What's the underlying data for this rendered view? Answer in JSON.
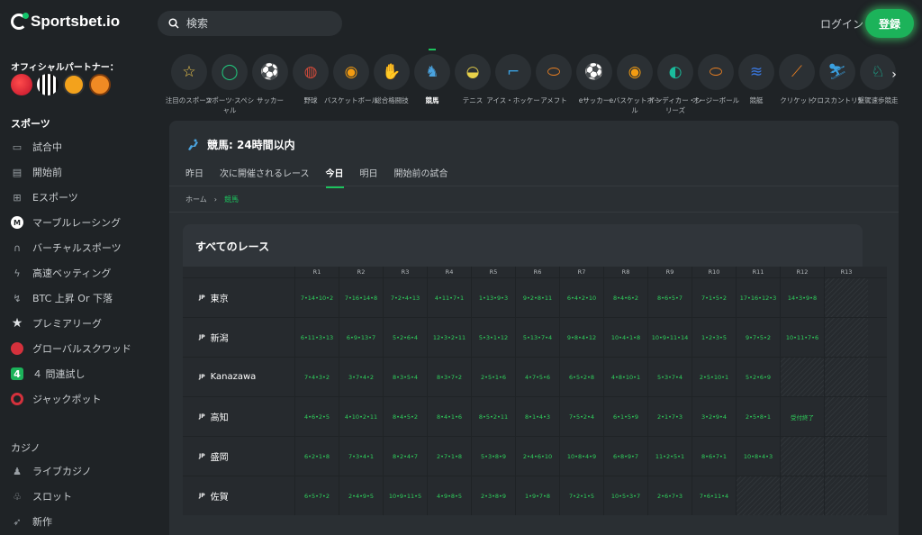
{
  "header": {
    "logo": "Sportsbet.io",
    "search_placeholder": "検索",
    "login": "ログイン",
    "register": "登録"
  },
  "sidebar": {
    "partner_label": "オフィシャルパートナー：",
    "partners": [
      "laliga",
      "newcastle",
      "wolves",
      "basketball"
    ],
    "sports_title": "スポーツ",
    "items": [
      {
        "label": "試合中",
        "icon": "monitor-icon"
      },
      {
        "label": "開始前",
        "icon": "calendar-icon"
      },
      {
        "label": "Eスポーツ",
        "icon": "gamepad-icon"
      },
      {
        "label": "マーブルレーシング",
        "icon": "marble-icon"
      },
      {
        "label": "バーチャルスポーツ",
        "icon": "headset-icon"
      },
      {
        "label": "高速ベッティング",
        "icon": "lightning-icon"
      },
      {
        "label": "BTC 上昇 Or 下落",
        "icon": "btc-icon"
      },
      {
        "label": "プレミアリーグ",
        "icon": "star-icon"
      },
      {
        "label": "グローバルスクワッド",
        "icon": "squad-icon"
      },
      {
        "label": "４ 問連試し",
        "icon": "four-icon"
      },
      {
        "label": "ジャックポット",
        "icon": "target-icon"
      }
    ],
    "casino_title": "カジノ",
    "casino_items": [
      {
        "label": "ライブカジノ",
        "icon": "dealer-icon"
      },
      {
        "label": "スロット",
        "icon": "slot-icon"
      },
      {
        "label": "新作",
        "icon": "rocket-icon"
      }
    ]
  },
  "categories": [
    {
      "label": "注目のスポーツ",
      "icon": "star-icon",
      "color": "#f2c94c"
    },
    {
      "label": "スポーツ·スペシャル",
      "icon": "special-icon",
      "color": "#21c07a"
    },
    {
      "label": "サッカー",
      "icon": "soccer-icon",
      "color": "#e53935"
    },
    {
      "label": "野球",
      "icon": "baseball-icon",
      "color": "#d04a3a"
    },
    {
      "label": "バスケットボール",
      "icon": "basketball-icon",
      "color": "#f39c12"
    },
    {
      "label": "総合格闘技",
      "icon": "glove-icon",
      "color": "#e0e0e0"
    },
    {
      "label": "競馬",
      "icon": "horse-icon",
      "color": "#4aa3df",
      "active": true
    },
    {
      "label": "テニス",
      "icon": "tennis-icon",
      "color": "#e8d14a"
    },
    {
      "label": "アイス・ホッケー",
      "icon": "hockey-icon",
      "color": "#3aa0e0"
    },
    {
      "label": "アメフト",
      "icon": "football-icon",
      "color": "#e67e22"
    },
    {
      "label": "eサッカー",
      "icon": "esoccer-icon",
      "color": "#e53935"
    },
    {
      "label": "eバスケットボール",
      "icon": "ebasketball-icon",
      "color": "#f39c12"
    },
    {
      "label": "インディカー・シリーズ",
      "icon": "helmet-icon",
      "color": "#1abc9c"
    },
    {
      "label": "オージーボール",
      "icon": "aussie-icon",
      "color": "#e67e22"
    },
    {
      "label": "競艇",
      "icon": "boat-icon",
      "color": "#3a78e0"
    },
    {
      "label": "クリケット",
      "icon": "cricket-icon",
      "color": "#e67e22"
    },
    {
      "label": "クロスカントリー",
      "icon": "skier-icon",
      "color": "#3aa0e0"
    },
    {
      "label": "繋駕速歩競走",
      "icon": "trotting-icon",
      "color": "#1abc9c"
    }
  ],
  "panel": {
    "title": "競馬: 24時間以内",
    "tabs": [
      "昨日",
      "次に開催されるレース",
      "今日",
      "明日",
      "開始前の試合"
    ],
    "active_tab": 2,
    "breadcrumb": {
      "home": "ホーム",
      "current": "競馬"
    },
    "races_title": "すべてのレース",
    "columns": [
      "R1",
      "R2",
      "R3",
      "R4",
      "R5",
      "R6",
      "R7",
      "R8",
      "R9",
      "R10",
      "R11",
      "R12",
      "R13"
    ],
    "rows": [
      {
        "country": "JP",
        "venue": "東京",
        "cells": [
          "7•14•10•2",
          "7•16•14•8",
          "7•2•4•13",
          "4•11•7•1",
          "1•13•9•3",
          "9•2•8•11",
          "6•4•2•10",
          "8•4•6•2",
          "8•6•5•7",
          "7•1•5•2",
          "17•16•12•3",
          "14•3•9•8",
          ""
        ]
      },
      {
        "country": "JP",
        "venue": "新潟",
        "cells": [
          "6•11•3•13",
          "6•9•13•7",
          "5•2•6•4",
          "12•3•2•11",
          "5•3•1•12",
          "5•13•7•4",
          "9•8•4•12",
          "10•4•1•8",
          "10•9•11•14",
          "1•2•3•5",
          "9•7•5•2",
          "10•11•7•6",
          ""
        ]
      },
      {
        "country": "JP",
        "venue": "Kanazawa",
        "cells": [
          "7•4•3•2",
          "3•7•4•2",
          "8•3•5•4",
          "8•3•7•2",
          "2•5•1•6",
          "4•7•5•6",
          "6•5•2•8",
          "4•8•10•1",
          "5•3•7•4",
          "2•5•10•1",
          "5•2•6•9",
          "",
          ""
        ]
      },
      {
        "country": "JP",
        "venue": "高知",
        "cells": [
          "4•6•2•5",
          "4•10•2•11",
          "8•4•5•2",
          "8•4•1•6",
          "8•5•2•11",
          "8•1•4•3",
          "7•5•2•4",
          "6•1•5•9",
          "2•1•7•3",
          "3•2•9•4",
          "2•5•8•1",
          "受付終了",
          ""
        ]
      },
      {
        "country": "JP",
        "venue": "盛岡",
        "cells": [
          "6•2•1•8",
          "7•3•4•1",
          "8•2•4•7",
          "2•7•1•8",
          "5•3•8•9",
          "2•4•6•10",
          "10•8•4•9",
          "6•8•9•7",
          "11•2•5•1",
          "8•6•7•1",
          "10•8•4•3",
          "",
          ""
        ]
      },
      {
        "country": "JP",
        "venue": "佐賀",
        "cells": [
          "6•5•7•2",
          "2•4•9•5",
          "10•9•11•5",
          "4•9•8•5",
          "2•3•8•9",
          "1•9•7•8",
          "7•2•1•5",
          "10•5•3•7",
          "2•6•7•3",
          "7•6•11•4",
          "",
          "",
          ""
        ]
      }
    ]
  }
}
